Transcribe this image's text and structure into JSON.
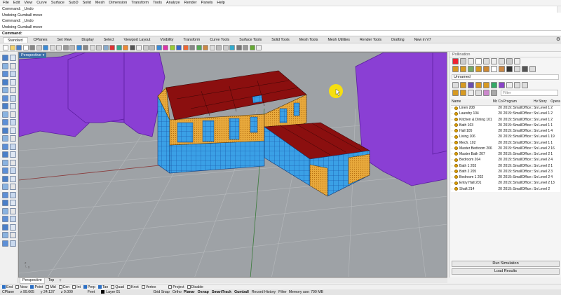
{
  "menu": [
    "File",
    "Edit",
    "View",
    "Curve",
    "Surface",
    "SubD",
    "Solid",
    "Mesh",
    "Dimension",
    "Transform",
    "Tools",
    "Analyze",
    "Render",
    "Panels",
    "Help"
  ],
  "command_history": [
    "Command: _Undo",
    "Undoing Gumball move",
    "Command: _Undo",
    "Undoing Gumball move"
  ],
  "command_prompt": "Command:",
  "toolbar_tabs": [
    "Standard",
    "CPlanes",
    "Set View",
    "Display",
    "Select",
    "Viewport Layout",
    "Visibility",
    "Transform",
    "Curve Tools",
    "Surface Tools",
    "Solid Tools",
    "Mesh Tools",
    "Mesh Utilities",
    "Render Tools",
    "Drafting",
    "New in V7"
  ],
  "active_toolbar_tab": "Standard",
  "viewport": {
    "title": "Perspective",
    "tabs": [
      "Perspective",
      "Top"
    ],
    "active_tab": "Perspective",
    "colors": {
      "background": "#9ea2a6",
      "wall": "#e8a93c",
      "roof": "#8b0f0f",
      "glazing": "#3aa0e6",
      "shade": "#8a3fd4",
      "cursor": "#ffe500"
    }
  },
  "osnaps": [
    {
      "label": "End",
      "on": true
    },
    {
      "label": "Near",
      "on": false
    },
    {
      "label": "Point",
      "on": true
    },
    {
      "label": "Mid",
      "on": false
    },
    {
      "label": "Cen",
      "on": false
    },
    {
      "label": "Int",
      "on": false
    },
    {
      "label": "Perp",
      "on": true
    },
    {
      "label": "Tan",
      "on": true
    },
    {
      "label": "Quad",
      "on": false
    },
    {
      "label": "Knot",
      "on": false
    },
    {
      "label": "Vertex",
      "on": false
    },
    {
      "label": "Project",
      "on": false
    },
    {
      "label": "Disable",
      "on": false
    }
  ],
  "status": {
    "cplane": "CPlane",
    "x": "x 99.665",
    "y": "y 24.137",
    "z": "z 0.000",
    "units": "Feet",
    "layer": "Layer 01",
    "grid_snap": "Grid Snap",
    "ortho": "Ortho",
    "planar": "Planar",
    "osnap": "Osnap",
    "smarttrack": "SmartTrack",
    "gumball": "Gumball",
    "record_history": "Record History",
    "filter": "Filter",
    "memory": "Memory use: 790 MB"
  },
  "panel": {
    "title": "Pollination",
    "model_name": "Unnamed",
    "filter_placeholder": "Filter",
    "columns": [
      "Name",
      "Mc",
      "Co",
      "Program",
      "Hv",
      "Story",
      "Opera"
    ],
    "rooms": [
      [
        "Linen 208",
        "",
        "20",
        "2019::SmallOffice::",
        "Sn",
        "Level 1",
        "2"
      ],
      [
        "Laundry 104",
        "",
        "20",
        "2019::SmallOffice::",
        "Sn",
        "Level 1",
        "2"
      ],
      [
        "Kitchen & Dining 101",
        "",
        "20",
        "2019::SmallOffice::",
        "Sn",
        "Level 1",
        "2"
      ],
      [
        "Bath 103",
        "",
        "20",
        "2019::SmallOffice::",
        "Sn",
        "Level 1",
        "1"
      ],
      [
        "Hall 105",
        "",
        "20",
        "2019::SmallOffice::",
        "Sn",
        "Level 1",
        "4"
      ],
      [
        "Living 106",
        "",
        "20",
        "2019::SmallOffice::",
        "Sn",
        "Level 1",
        "19"
      ],
      [
        "Mech. 102",
        "",
        "20",
        "2019::SmallOffice::",
        "Sn",
        "Level 1",
        "1"
      ],
      [
        "Master Bedroom 206",
        "",
        "20",
        "2019::SmallOffice::",
        "Sn",
        "Level 2",
        "16"
      ],
      [
        "Master Bath 207",
        "",
        "20",
        "2019::SmallOffice::",
        "Sn",
        "Level 2",
        "1"
      ],
      [
        "Bedroom 204",
        "",
        "20",
        "2019::SmallOffice::",
        "Sn",
        "Level 2",
        "4"
      ],
      [
        "Bath 1 203",
        "",
        "20",
        "2019::SmallOffice::",
        "Sn",
        "Level 2",
        "1"
      ],
      [
        "Bath 2 205",
        "",
        "20",
        "2019::SmallOffice::",
        "Sn",
        "Level 2",
        "3"
      ],
      [
        "Bedroom 1 202",
        "",
        "20",
        "2019::SmallOffice::",
        "Sn",
        "Level 2",
        "4"
      ],
      [
        "Entry Hall 201",
        "",
        "20",
        "2019::SmallOffice::",
        "Sn",
        "Level 2",
        "13"
      ],
      [
        "Shaft 214",
        "",
        "20",
        "2019::SmallOffice::",
        "Sn",
        "Level 2",
        ""
      ]
    ],
    "run_button": "Run Simulation",
    "load_button": "Load Results"
  }
}
